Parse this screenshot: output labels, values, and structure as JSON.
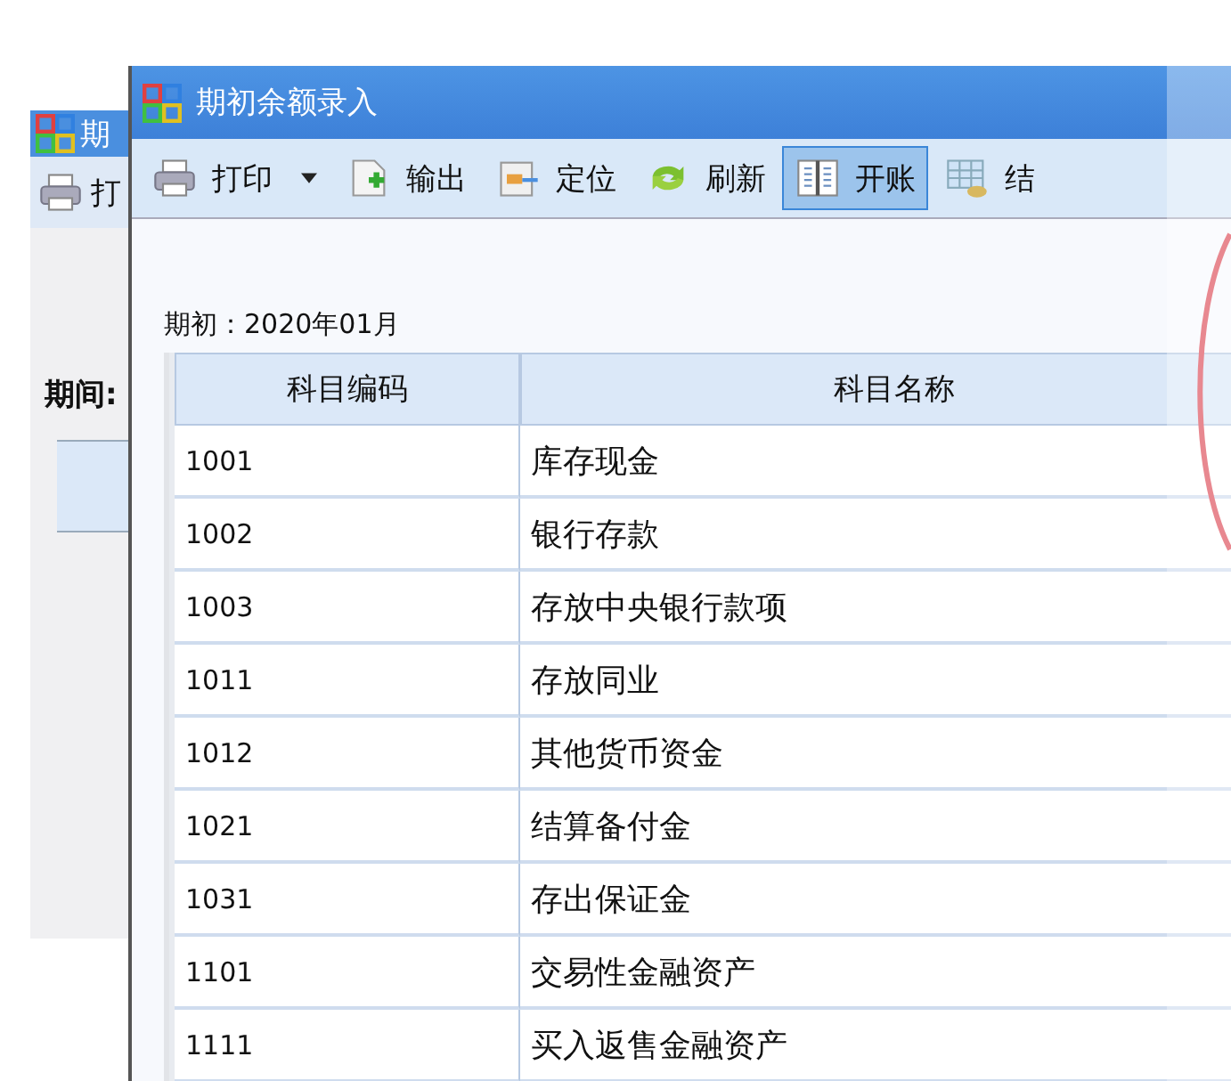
{
  "background_window": {
    "title": "期",
    "toolbar_label": "打",
    "period_label": "期间:"
  },
  "window": {
    "title": "期初余额录入"
  },
  "toolbar": [
    {
      "label": "打印",
      "kind": "print",
      "dropdown": true,
      "selected": false
    },
    {
      "label": "输出",
      "kind": "export",
      "dropdown": false,
      "selected": false
    },
    {
      "label": "定位",
      "kind": "locate",
      "dropdown": false,
      "selected": false
    },
    {
      "label": "刷新",
      "kind": "refresh",
      "dropdown": false,
      "selected": false
    },
    {
      "label": "开账",
      "kind": "open",
      "dropdown": false,
      "selected": true
    },
    {
      "label": "结",
      "kind": "close",
      "dropdown": false,
      "selected": false
    }
  ],
  "period": "期初：2020年01月",
  "table": {
    "columns": [
      "科目编码",
      "科目名称"
    ],
    "rows": [
      {
        "code": "1001",
        "name": "库存现金"
      },
      {
        "code": "1002",
        "name": "银行存款"
      },
      {
        "code": "1003",
        "name": "存放中央银行款项"
      },
      {
        "code": "1011",
        "name": "存放同业"
      },
      {
        "code": "1012",
        "name": "其他货币资金"
      },
      {
        "code": "1021",
        "name": "结算备付金"
      },
      {
        "code": "1031",
        "name": "存出保证金"
      },
      {
        "code": "1101",
        "name": "交易性金融资产"
      },
      {
        "code": "1111",
        "name": "买入返售金融资产"
      }
    ]
  }
}
